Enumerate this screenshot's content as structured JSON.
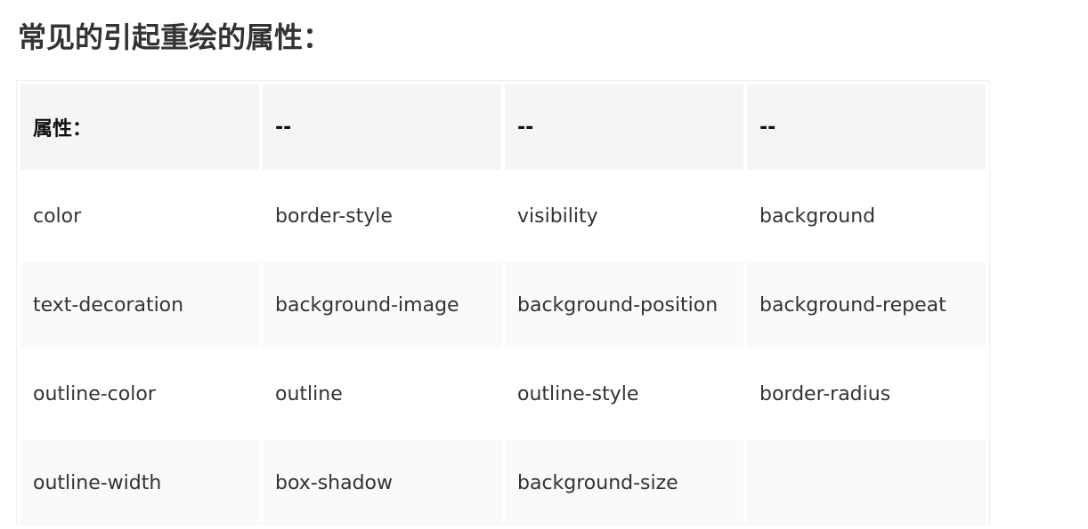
{
  "heading": "常见的引起重绘的属性：",
  "table": {
    "headers": [
      "属性：",
      "--",
      "--",
      "--"
    ],
    "rows": [
      [
        "color",
        "border-style",
        "visibility",
        "background"
      ],
      [
        "text-decoration",
        "background-image",
        "background-position",
        "background-repeat"
      ],
      [
        "outline-color",
        "outline",
        "outline-style",
        "border-radius"
      ],
      [
        "outline-width",
        "box-shadow",
        "background-size",
        ""
      ]
    ]
  }
}
